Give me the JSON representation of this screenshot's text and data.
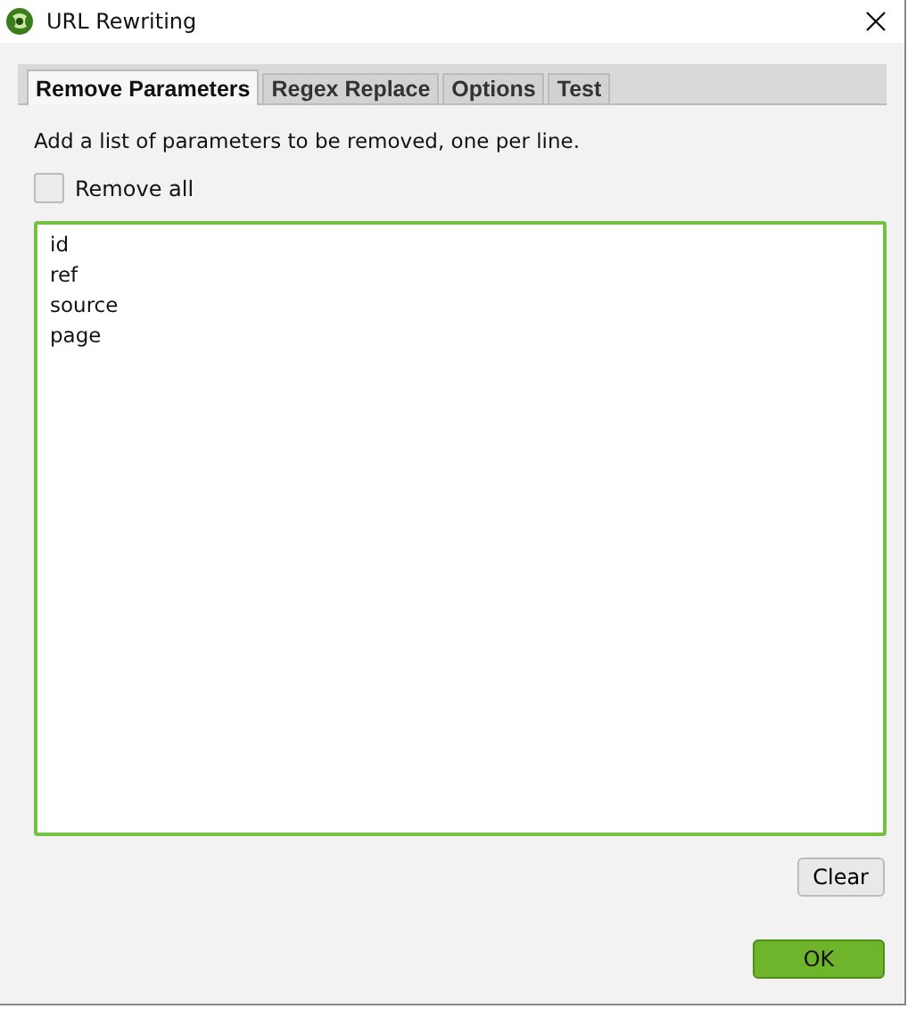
{
  "window": {
    "title": "URL Rewriting"
  },
  "tabs": [
    {
      "label": "Remove Parameters",
      "selected": true
    },
    {
      "label": "Regex Replace",
      "selected": false
    },
    {
      "label": "Options",
      "selected": false
    },
    {
      "label": "Test",
      "selected": false
    }
  ],
  "description": "Add a list of parameters to be removed, one per line.",
  "remove_all": {
    "label": "Remove all",
    "checked": false
  },
  "parameters": {
    "value": "id\nref\nsource\npage",
    "focused": true
  },
  "buttons": {
    "clear": "Clear",
    "ok": "OK"
  }
}
